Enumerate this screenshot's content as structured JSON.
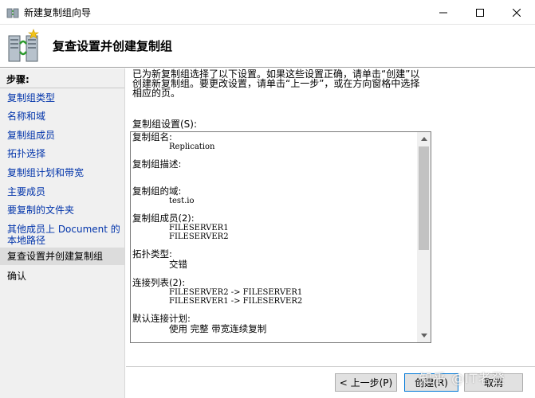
{
  "window": {
    "title": "新建复制组向导"
  },
  "header": {
    "page_title": "复查设置并创建复制组"
  },
  "sidebar": {
    "heading": "步骤:",
    "items": [
      {
        "label": "复制组类型"
      },
      {
        "label": "名称和域"
      },
      {
        "label": "复制组成员"
      },
      {
        "label": "拓扑选择"
      },
      {
        "label": "复制组计划和带宽"
      },
      {
        "label": "主要成员"
      },
      {
        "label": "要复制的文件夹"
      },
      {
        "label": "其他成员上 Document 的本地路径"
      },
      {
        "label": "复查设置并创建复制组"
      },
      {
        "label": "确认"
      }
    ]
  },
  "content": {
    "intro": "已为新复制组选择了以下设置。如果这些设置正确，请单击“创建”以创建新复制组。要更改设置，请单击“上一步”，或在方向窗格中选择相应的页。",
    "settings_label": "复制组设置(S):",
    "settings": {
      "group_name_label": "复制组名:",
      "group_name": "Replication",
      "description_label": "复制组描述:",
      "domain_label": "复制组的域:",
      "domain": "test.io",
      "members_label": "复制组成员(2):",
      "members": [
        "FILESERVER1",
        "FILESERVER2"
      ],
      "topology_label": "拓扑类型:",
      "topology": "交错",
      "connections_label": "连接列表(2):",
      "connections": [
        "FILESERVER2 -> FILESERVER1",
        "FILESERVER1 -> FILESERVER2"
      ],
      "schedule_label": "默认连接计划:",
      "schedule": "使用 完整 带宽连续复制"
    }
  },
  "buttons": {
    "back": "< 上一步(P)",
    "create": "创建(R)",
    "cancel": "取消"
  },
  "watermark": "知乎 @IT老登",
  "colors": {
    "link": "#0033aa",
    "sidebar_bg": "#f0f0f0",
    "selected_bg": "#dcdcdc",
    "primary_border": "#0078d7"
  }
}
